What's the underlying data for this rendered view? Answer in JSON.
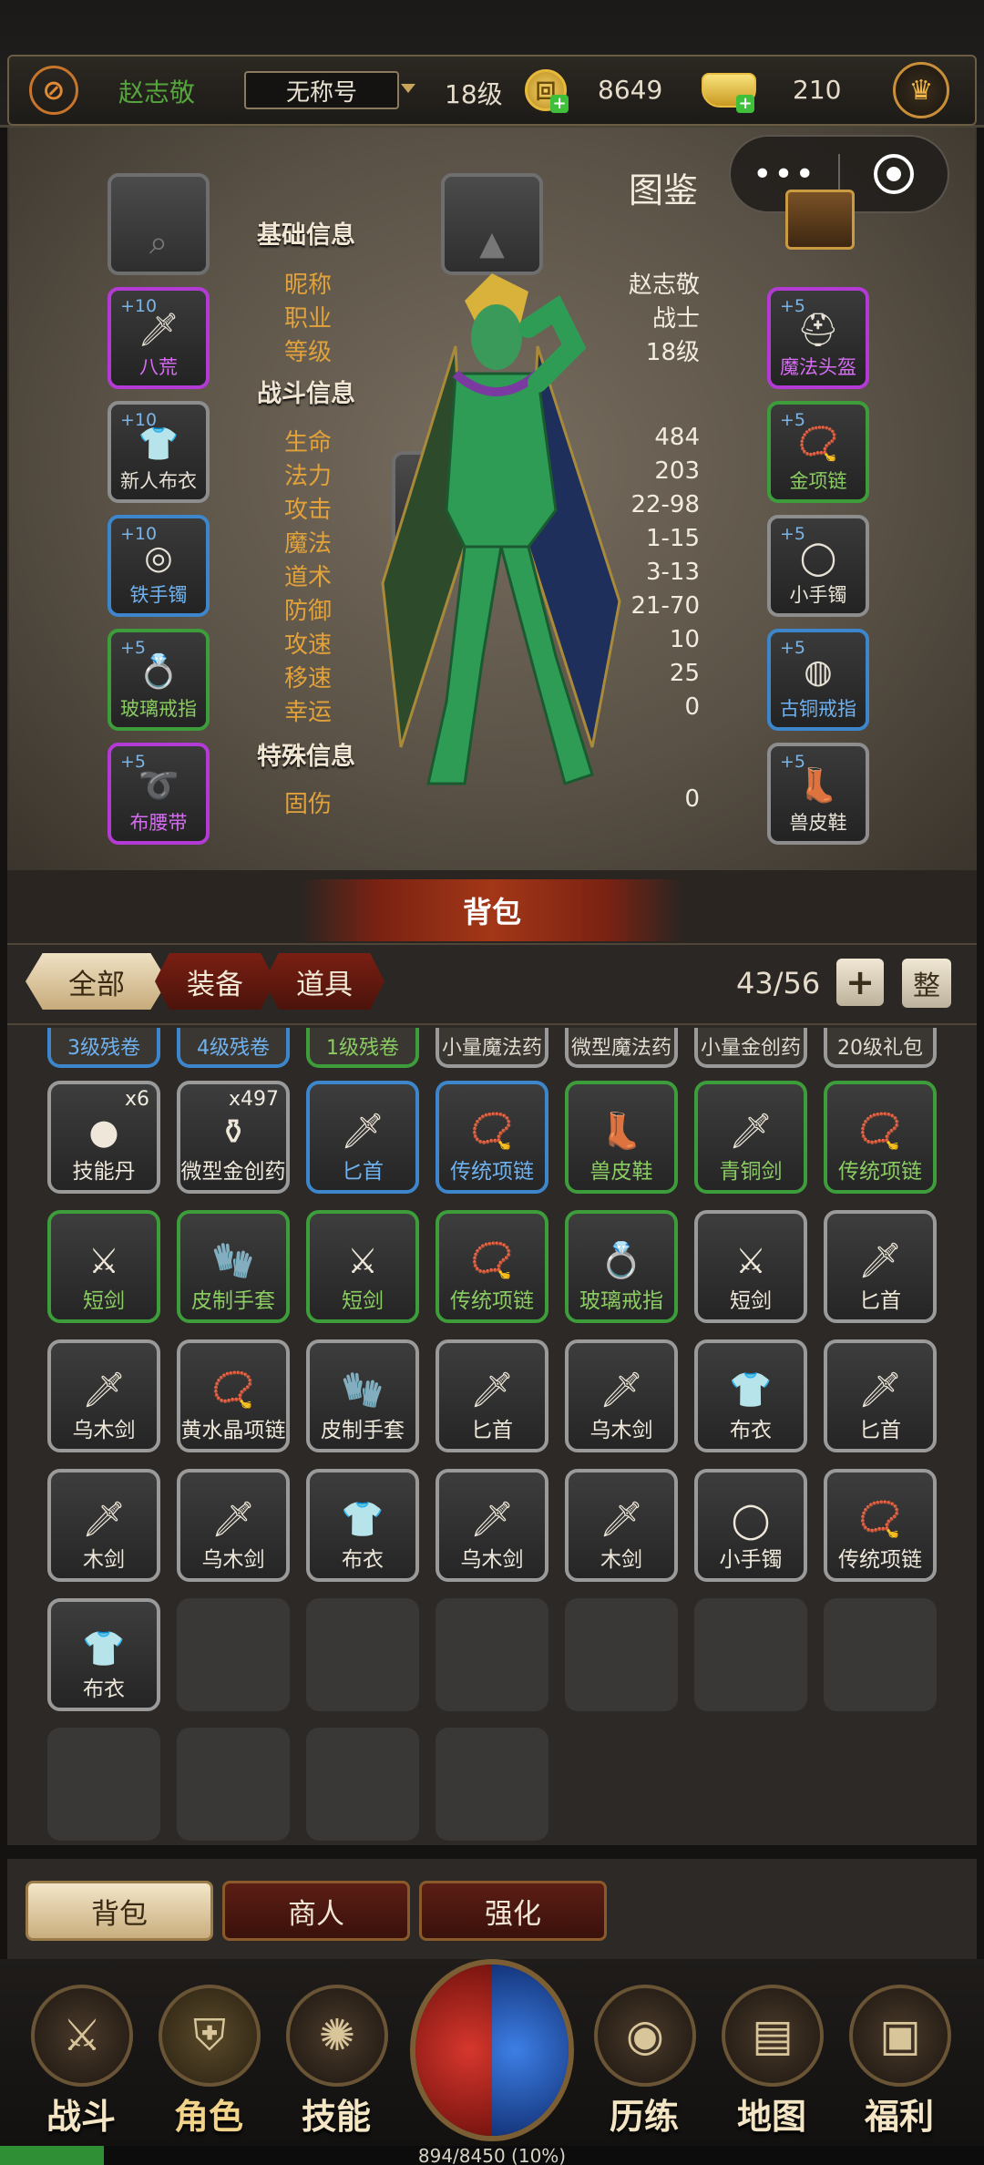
{
  "header": {
    "player_name": "赵志敬",
    "title": "无称号",
    "level": "18级",
    "copper": "8649",
    "gold": "210",
    "icons": {
      "logo": "rune-logo-icon",
      "copper": "copper-coin-icon",
      "gold": "gold-ingot-icon",
      "vip": "crown-icon",
      "add": "plus-icon"
    }
  },
  "miniapp": {
    "menu": "•••",
    "close": "target-icon"
  },
  "character": {
    "tujian": "图鉴",
    "sections": {
      "basic": "基础信息",
      "battle": "战斗信息",
      "special": "特殊信息"
    },
    "basic": [
      [
        "昵称",
        "赵志敬"
      ],
      [
        "职业",
        "战士"
      ],
      [
        "等级",
        "18级"
      ]
    ],
    "battle": [
      [
        "生命",
        "484"
      ],
      [
        "法力",
        "203"
      ],
      [
        "攻击",
        "22-98"
      ],
      [
        "魔法",
        "1-15"
      ],
      [
        "道术",
        "3-13"
      ],
      [
        "防御",
        "21-70"
      ],
      [
        "攻速",
        "10"
      ],
      [
        "移速",
        "25"
      ],
      [
        "幸运",
        "0"
      ]
    ],
    "special": [
      [
        "固伤",
        "0"
      ]
    ],
    "left_slots": [
      {
        "plus": "",
        "name": ""
      },
      {
        "plus": "+10",
        "name": "八荒"
      },
      {
        "plus": "+10",
        "name": "新人布衣"
      },
      {
        "plus": "+10",
        "name": "铁手镯"
      },
      {
        "plus": "+5",
        "name": "玻璃戒指"
      },
      {
        "plus": "+5",
        "name": "布腰带"
      }
    ],
    "right_slots": [
      {
        "plus": "+5",
        "name": "魔法头盔"
      },
      {
        "plus": "+5",
        "name": "金项链"
      },
      {
        "plus": "+5",
        "name": "小手镯"
      },
      {
        "plus": "+5",
        "name": "古铜戒指"
      },
      {
        "plus": "+5",
        "name": "兽皮鞋"
      }
    ]
  },
  "bag": {
    "title": "背包",
    "tabs": [
      "全部",
      "装备",
      "道具"
    ],
    "count": "43/56",
    "plus": "+",
    "sort": "整",
    "partial_row": [
      "3级残卷",
      "4级残卷",
      "1级残卷",
      "小量魔法药",
      "微型魔法药",
      "小量金创药",
      "20级礼包"
    ],
    "rows": [
      [
        {
          "n": "技能丹",
          "q": "x6",
          "i": "●"
        },
        {
          "n": "微型金创药",
          "q": "x497",
          "i": "⚱"
        },
        {
          "n": "匕首",
          "q": "",
          "i": "🗡"
        },
        {
          "n": "传统项链",
          "q": "",
          "i": "📿"
        },
        {
          "n": "兽皮鞋",
          "q": "",
          "i": "👢"
        },
        {
          "n": "青铜剑",
          "q": "",
          "i": "🗡"
        },
        {
          "n": "传统项链",
          "q": "",
          "i": "📿"
        }
      ],
      [
        {
          "n": "短剑",
          "q": "",
          "i": "⚔"
        },
        {
          "n": "皮制手套",
          "q": "",
          "i": "🧤"
        },
        {
          "n": "短剑",
          "q": "",
          "i": "⚔"
        },
        {
          "n": "传统项链",
          "q": "",
          "i": "📿"
        },
        {
          "n": "玻璃戒指",
          "q": "",
          "i": "💍"
        },
        {
          "n": "短剑",
          "q": "",
          "i": "⚔"
        },
        {
          "n": "匕首",
          "q": "",
          "i": "🗡"
        }
      ],
      [
        {
          "n": "乌木剑",
          "q": "",
          "i": "🗡"
        },
        {
          "n": "黄水晶项链",
          "q": "",
          "i": "📿"
        },
        {
          "n": "皮制手套",
          "q": "",
          "i": "🧤"
        },
        {
          "n": "匕首",
          "q": "",
          "i": "🗡"
        },
        {
          "n": "乌木剑",
          "q": "",
          "i": "🗡"
        },
        {
          "n": "布衣",
          "q": "",
          "i": "👕"
        },
        {
          "n": "匕首",
          "q": "",
          "i": "🗡"
        }
      ],
      [
        {
          "n": "木剑",
          "q": "",
          "i": "🗡"
        },
        {
          "n": "乌木剑",
          "q": "",
          "i": "🗡"
        },
        {
          "n": "布衣",
          "q": "",
          "i": "👕"
        },
        {
          "n": "乌木剑",
          "q": "",
          "i": "🗡"
        },
        {
          "n": "木剑",
          "q": "",
          "i": "🗡"
        },
        {
          "n": "小手镯",
          "q": "",
          "i": "◯"
        },
        {
          "n": "传统项链",
          "q": "",
          "i": "📿"
        }
      ],
      [
        {
          "n": "布衣",
          "q": "",
          "i": "👕"
        }
      ]
    ],
    "bottom_tabs": [
      "背包",
      "商人",
      "强化"
    ]
  },
  "nav": {
    "items": [
      "战斗",
      "角色",
      "技能",
      "历练",
      "地图",
      "福利"
    ],
    "exp_text": "894/8450 (10%)",
    "exp_fraction": 0.106
  }
}
